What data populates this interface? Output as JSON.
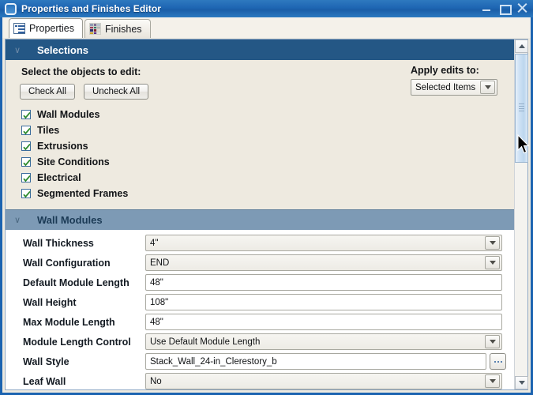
{
  "window": {
    "title": "Properties and Finishes Editor",
    "icon": "rounded-square-icon",
    "controls": {
      "minimize": "–",
      "maximize": "□",
      "close": "✕"
    }
  },
  "tabs": [
    {
      "label": "Properties",
      "icon": "list-icon",
      "active": true
    },
    {
      "label": "Finishes",
      "icon": "color-swatch-grid-icon",
      "active": false
    }
  ],
  "selections": {
    "header": "Selections",
    "chevron": "∨",
    "prompt": "Select the objects to edit:",
    "buttons": {
      "check_all": "Check All",
      "uncheck_all": "Uncheck All"
    },
    "apply": {
      "label": "Apply edits to:",
      "value": "Selected Items",
      "options": [
        "Selected Items"
      ]
    },
    "items": [
      {
        "label": "Wall Modules",
        "checked": true
      },
      {
        "label": "Tiles",
        "checked": true
      },
      {
        "label": "Extrusions",
        "checked": true
      },
      {
        "label": "Site Conditions",
        "checked": true
      },
      {
        "label": "Electrical",
        "checked": true
      },
      {
        "label": "Segmented Frames",
        "checked": true
      }
    ]
  },
  "wall_modules": {
    "header": "Wall Modules",
    "chevron": "∨",
    "fields": [
      {
        "label": "Wall Thickness",
        "value": "4\"",
        "type": "dropdown"
      },
      {
        "label": "Wall Configuration",
        "value": "END",
        "type": "dropdown"
      },
      {
        "label": "Default Module Length",
        "value": "48\"",
        "type": "text"
      },
      {
        "label": "Wall Height",
        "value": "108\"",
        "type": "text"
      },
      {
        "label": "Max Module Length",
        "value": "48\"",
        "type": "text"
      },
      {
        "label": "Module Length Control",
        "value": "Use Default Module Length",
        "type": "dropdown"
      },
      {
        "label": "Wall Style",
        "value": "Stack_Wall_24-in_Clerestory_b",
        "type": "browse"
      },
      {
        "label": "Leaf Wall",
        "value": "No",
        "type": "dropdown"
      }
    ]
  },
  "scrollbar": {
    "up_arrow": "▲",
    "down_arrow": "▼",
    "thumb_position_pct": 4,
    "thumb_size_pct": 31
  },
  "colors": {
    "titlebar": "#1e66b3",
    "section_primary": "#245785",
    "section_secondary": "#7d9ab5",
    "panel_background": "#eeeae0",
    "check_mark": "#2e8b2e",
    "scroll_thumb": "#cfe2f5"
  },
  "swatch_colors": [
    "#8f9bb3",
    "#7e6f96",
    "#b8c5cf",
    "#9e3e5a",
    "#2f7b6b",
    "#b7b7b7",
    "#2a2f6b",
    "#7f1f2f",
    "#dedbd2",
    "#c9a227",
    "#5b2b8a",
    "#e8e6de"
  ]
}
